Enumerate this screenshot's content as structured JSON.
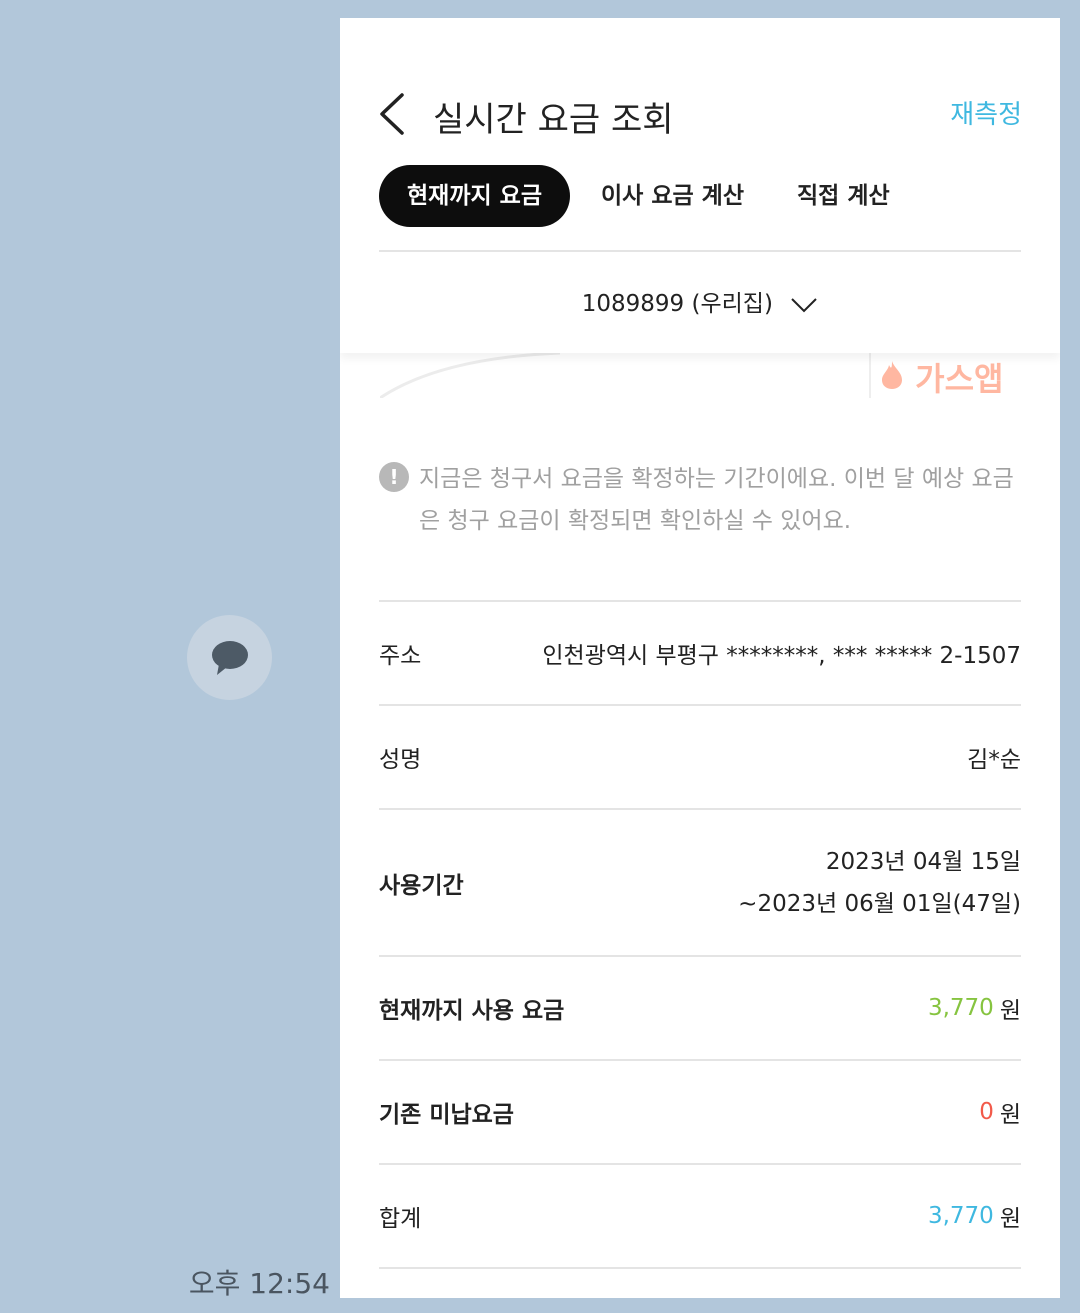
{
  "chat": {
    "timestamp": "오후 12:54",
    "bubble_icon": "speech-bubble-icon"
  },
  "header": {
    "title": "실시간 요금 조회",
    "back_icon": "chevron-left-icon",
    "remeasure_label": "재측정",
    "accent_color": "#3fb8e0"
  },
  "tabs": [
    {
      "label": "현재까지 요금",
      "active": true
    },
    {
      "label": "이사 요금 계산",
      "active": false
    },
    {
      "label": "직접 계산",
      "active": false
    }
  ],
  "account": {
    "selected": "1089899 (우리집)",
    "dropdown_icon": "chevron-down-icon"
  },
  "banner": {
    "logo_text": "가스앱",
    "logo_icon": "flame-icon"
  },
  "notice": {
    "icon": "exclamation-icon",
    "text": "지금은 청구서 요금을 확정하는 기간이에요. 이번 달 예상 요금은 청구 요금이 확정되면 확인하실 수 있어요."
  },
  "rows": {
    "address": {
      "label": "주소",
      "value": "인천광역시 부평구 ********, *** ***** 2-1507"
    },
    "name": {
      "label": "성명",
      "value": "김*순"
    },
    "period": {
      "label": "사용기간",
      "start": "2023년 04월 15일",
      "end": "~2023년 06월 01일(47일)"
    },
    "current_charge": {
      "label": "현재까지 사용 요금",
      "amount": "3,770",
      "unit": "원",
      "color": "#86c440"
    },
    "unpaid": {
      "label": "기존 미납요금",
      "amount": "0",
      "unit": "원",
      "color": "#f25a4a"
    },
    "total": {
      "label": "합계",
      "amount": "3,770",
      "unit": "원",
      "color": "#3fb8e0"
    }
  }
}
